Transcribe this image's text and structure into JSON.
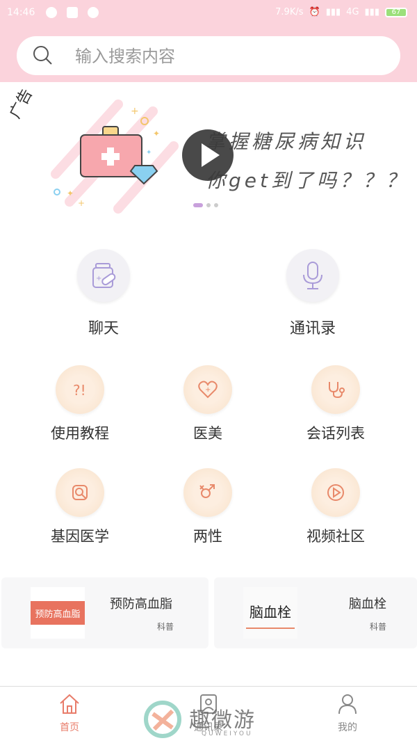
{
  "status_bar": {
    "time": "14:46",
    "net_speed": "7.9K/s",
    "signal": "4G",
    "battery": "67"
  },
  "search": {
    "placeholder": "输入搜索内容"
  },
  "banner": {
    "ad_label": "广告",
    "line1": "掌握糖尿病知识",
    "line2": "你get到了吗？？？",
    "slides": 3,
    "active_slide": 1
  },
  "main_features": [
    {
      "label": "聊天",
      "icon": "medicine-bottle-icon"
    },
    {
      "label": "通讯录",
      "icon": "microphone-icon"
    }
  ],
  "features": [
    {
      "label": "使用教程",
      "icon": "question-icon"
    },
    {
      "label": "医美",
      "icon": "heart-icon"
    },
    {
      "label": "会话列表",
      "icon": "stethoscope-icon"
    },
    {
      "label": "基因医学",
      "icon": "search-document-icon"
    },
    {
      "label": "两性",
      "icon": "gender-icon"
    },
    {
      "label": "视频社区",
      "icon": "play-circle-icon"
    }
  ],
  "articles": [
    {
      "thumb_text": "预防高血脂",
      "title": "预防高血脂",
      "tag": "科普"
    },
    {
      "thumb_text": "脑血栓",
      "title": "脑血栓",
      "tag": "科普"
    }
  ],
  "tabbar": [
    {
      "label": "首页",
      "icon": "home-icon",
      "active": true
    },
    {
      "label": "通讯录",
      "icon": "contacts-icon",
      "active": false
    },
    {
      "label": "我的",
      "icon": "user-icon",
      "active": false
    }
  ],
  "watermark": {
    "text": "趣微游",
    "sub": "QUWEIYOU"
  },
  "colors": {
    "header_pink": "#fbd3dc",
    "accent": "#e87c6a",
    "icon_purple": "#a99bd8",
    "icon_orange": "#e8896a"
  }
}
